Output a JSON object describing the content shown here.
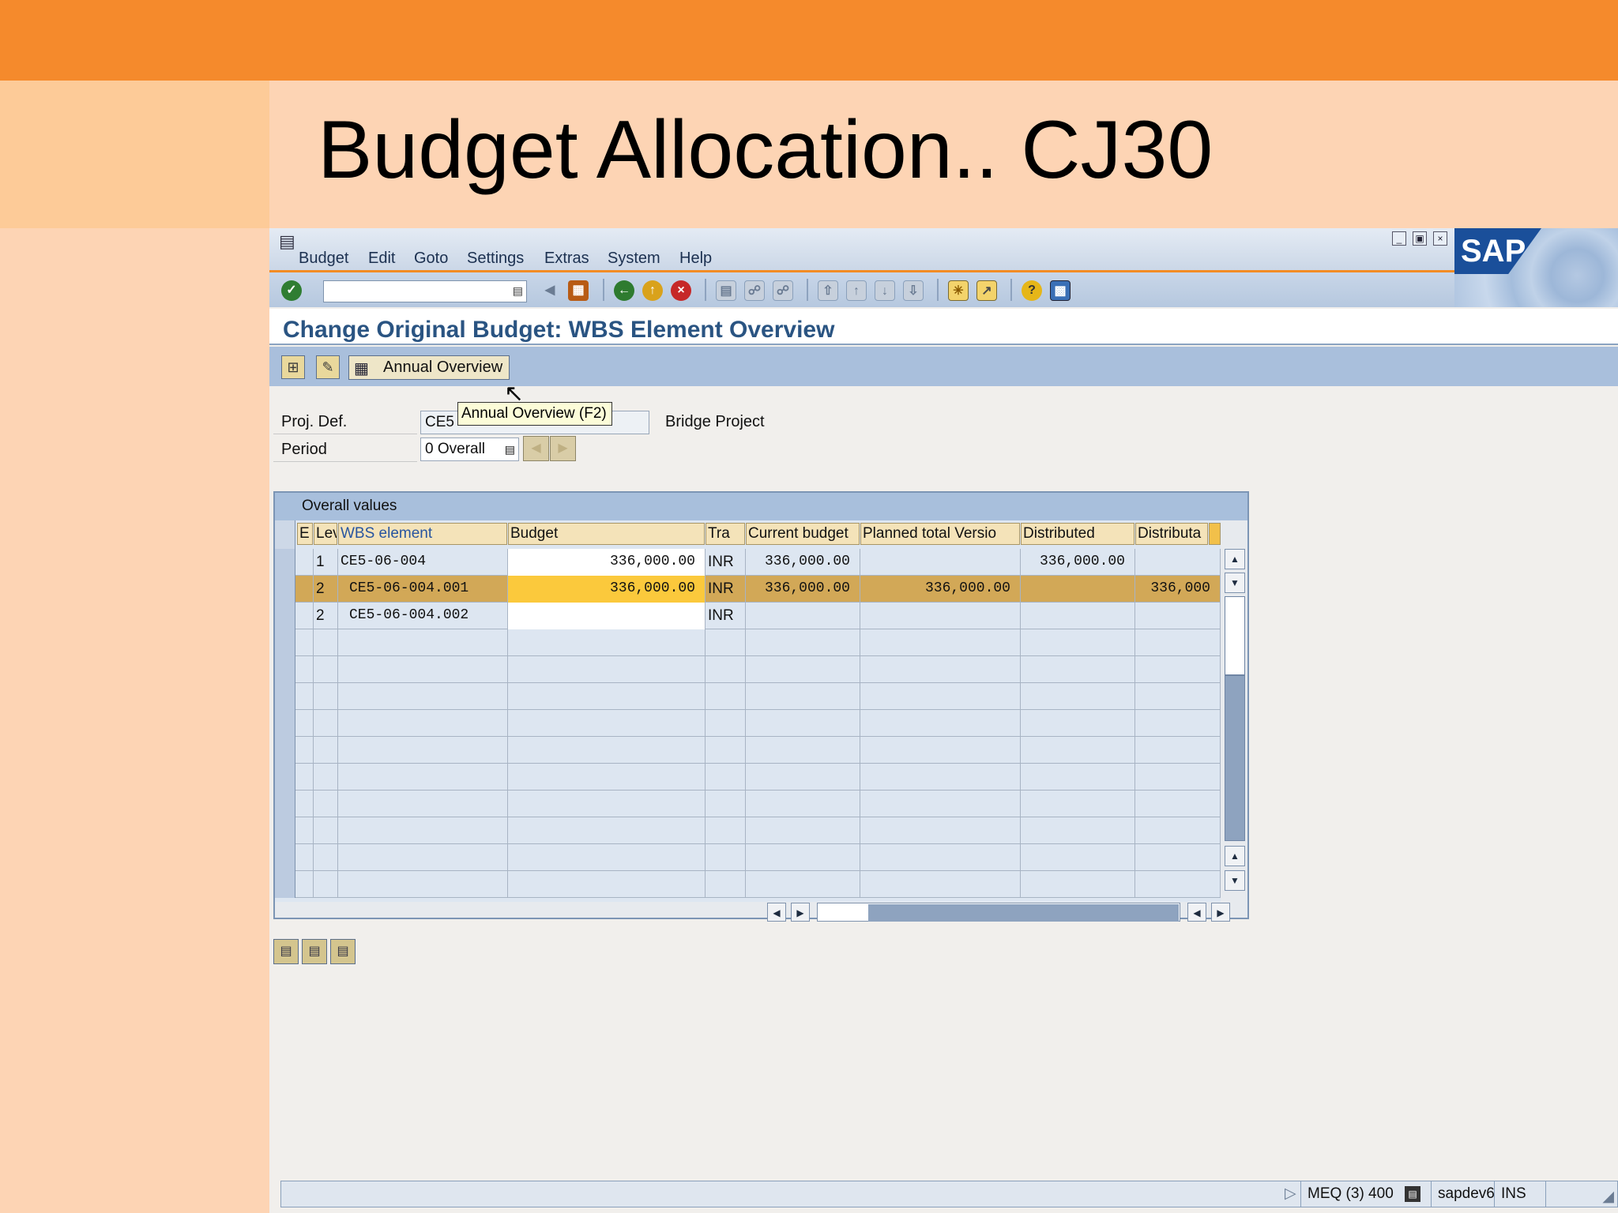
{
  "slide": {
    "title": "Budget Allocation.. CJ30"
  },
  "menu": {
    "items": [
      "Budget",
      "Edit",
      "Goto",
      "Settings",
      "Extras",
      "System",
      "Help"
    ]
  },
  "logo": {
    "text": "SAP"
  },
  "screen": {
    "title": "Change Original Budget: WBS Element Overview",
    "annual_overview_label": "Annual Overview",
    "tooltip": "Annual Overview   (F2)"
  },
  "header_fields": {
    "proj_def_label": "Proj. Def.",
    "proj_def_value": "CE5",
    "proj_desc": "Bridge Project",
    "period_label": "Period",
    "period_value": "0 Overall"
  },
  "table": {
    "group_title": "Overall values",
    "columns": [
      "E",
      "Lev",
      "WBS element",
      "Budget",
      "Tra",
      "Current budget",
      "Planned total Versio",
      "Distributed",
      "Distributa"
    ],
    "rows": [
      {
        "lev": "1",
        "wbs": "CE5-06-004",
        "budget": "336,000.00",
        "tra": "INR",
        "current": "336,000.00",
        "planned": "",
        "distributed": "336,000.00",
        "distributable": ""
      },
      {
        "lev": "2",
        "wbs": "CE5-06-004.001",
        "budget": "336,000.00",
        "tra": "INR",
        "current": "336,000.00",
        "planned": "336,000.00",
        "distributed": "",
        "distributable": "336,000"
      },
      {
        "lev": "2",
        "wbs": "CE5-06-004.002",
        "budget": "",
        "tra": "INR",
        "current": "",
        "planned": "",
        "distributed": "",
        "distributable": ""
      }
    ],
    "selected_row": 1,
    "empty_rows": 10
  },
  "status": {
    "system": "MEQ (3) 400",
    "server": "sapdev6",
    "mode": "INS"
  },
  "colors": {
    "top_bar": "#f58a2c",
    "slide_bg": "#fdd4b4",
    "title_blue": "#2a5482",
    "selected_row": "#d2a857",
    "selected_input": "#fbc93c"
  }
}
